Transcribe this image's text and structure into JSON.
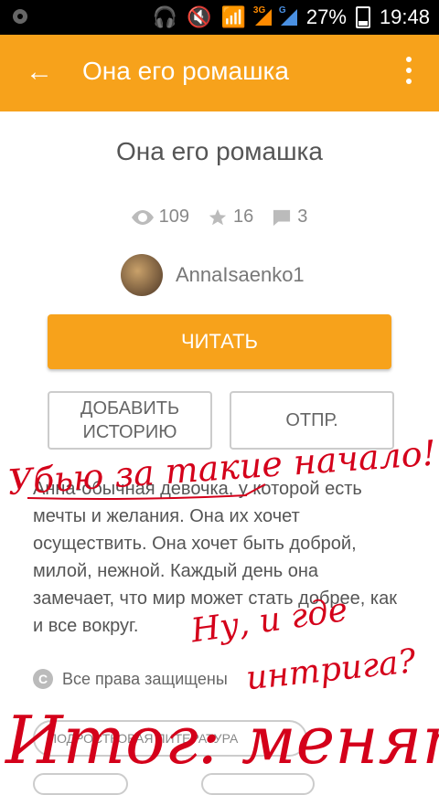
{
  "status_bar": {
    "net1": "3G",
    "net2": "G",
    "battery": "27%",
    "time": "19:48"
  },
  "toolbar": {
    "title": "Она его ромашка",
    "back_icon": "arrow-back-icon",
    "menu_icon": "more-vert-icon"
  },
  "story": {
    "title": "Она его ромашка",
    "views": "109",
    "stars": "16",
    "comments": "3",
    "author": "AnnaIsaenko1",
    "read_label": "ЧИТАТЬ",
    "add_label": "ДОБАВИТЬ ИСТОРИЮ",
    "send_label": "ОТПР.",
    "description": "Анна-обычная девочка, у которой есть мечты и желания. Она их хочет осуществить. Она хочет быть доброй, милой, нежной. Каждый день она замечает, что мир может стать добрее, как и все вокруг.",
    "rights": "Все права защищены",
    "tag": "ПОДРОСТКОВАЯ ЛИТЕРАТУРА"
  },
  "annotations": {
    "line1": "Убью за такие начало!",
    "line2": "Ну, и где",
    "line3": "интрига?",
    "line4": "Итог: менять"
  },
  "colors": {
    "accent": "#f7a21b",
    "ink": "#d4001a"
  }
}
